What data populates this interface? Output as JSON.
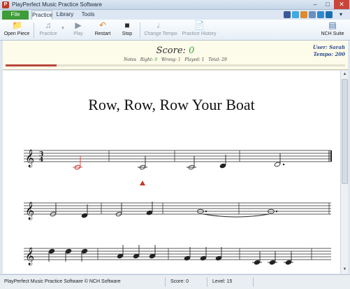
{
  "window": {
    "title": "PlayPerfect Music Practice Software"
  },
  "menu": {
    "file": "File",
    "tabs": [
      "Practice",
      "Library",
      "Tools"
    ]
  },
  "share_icons": [
    "facebook-icon",
    "twitter-icon",
    "share-icon",
    "blog-icon",
    "image-icon",
    "linkedin-icon"
  ],
  "ribbon": {
    "open_piece": "Open Piece",
    "practice": "Practice",
    "play": "Play",
    "restart": "Restart",
    "stop": "Stop",
    "change_tempo": "Change Tempo",
    "practice_history": "Practice History",
    "nch_suite": "NCH Suite"
  },
  "score": {
    "label": "Score:",
    "value": "0",
    "notes_label": "Notes",
    "right_label": "Right:",
    "right": "0",
    "wrong_label": "Wrong:",
    "wrong": "1",
    "played_label": "Played:",
    "played": "1",
    "total_label": "Total:",
    "total": "29",
    "progress_fraction": 0.15
  },
  "user": {
    "user_label": "User:",
    "name": "Sarah",
    "tempo_label": "Tempo:",
    "tempo": "200"
  },
  "sheet": {
    "title": "Row, Row, Row Your Boat",
    "time_signature_top": "3",
    "time_signature_bottom": "4"
  },
  "status": {
    "copyright": "PlayPerfect Music Practice Software © NCH Software",
    "score_label": "Score: 0",
    "level_label": "Level: 15"
  },
  "colors": {
    "accent_green": "#3aaa35",
    "wrong_red": "#cc3333",
    "progress": "#b8483e"
  }
}
